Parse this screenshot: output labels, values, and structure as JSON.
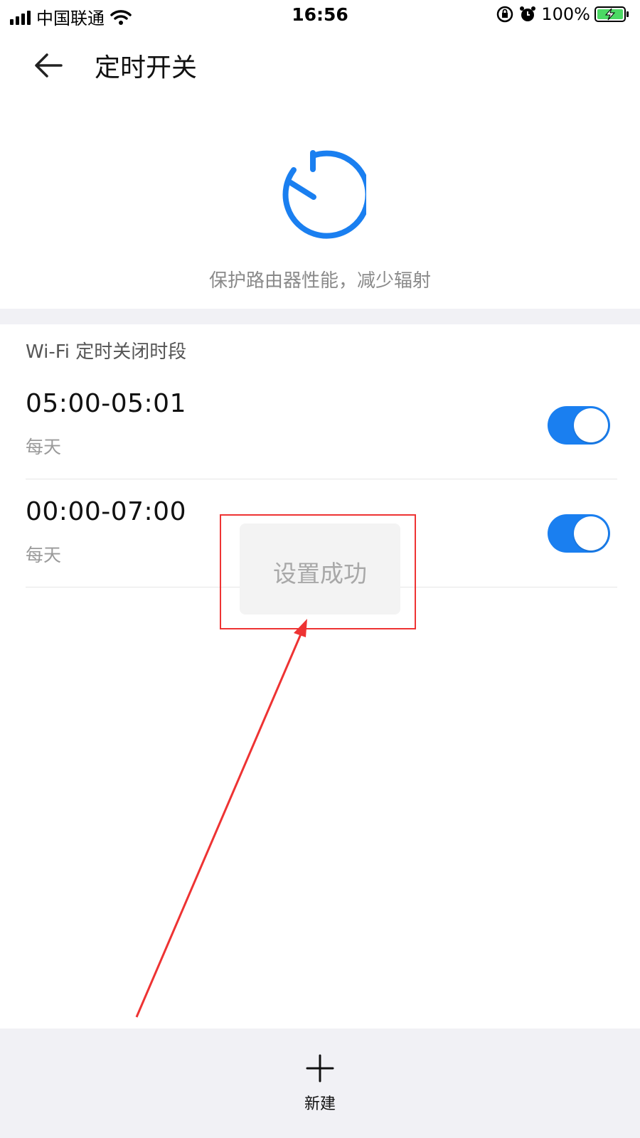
{
  "status_bar": {
    "carrier": "中国联通",
    "time": "16:56",
    "battery": "100%"
  },
  "header": {
    "title": "定时开关"
  },
  "hero": {
    "icon": "timer-icon",
    "subtitle": "保护路由器性能，减少辐射"
  },
  "section": {
    "title": "Wi-Fi 定时关闭时段",
    "items": [
      {
        "time": "05:00-05:01",
        "repeat": "每天",
        "enabled": true
      },
      {
        "time": "00:00-07:00",
        "repeat": "每天",
        "enabled": true
      }
    ]
  },
  "toast": {
    "text": "设置成功"
  },
  "bottom": {
    "new_label": "新建"
  },
  "colors": {
    "accent": "#1a7ff0",
    "annotation": "#e33333"
  }
}
